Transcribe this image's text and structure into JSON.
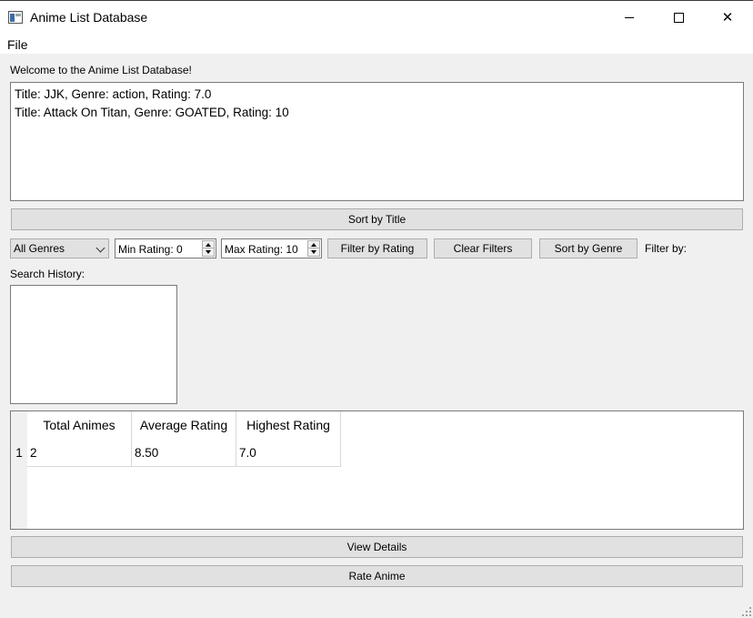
{
  "window": {
    "title": "Anime List Database",
    "minimize_glyph": "",
    "close_glyph": "✕"
  },
  "menu": {
    "file": "File"
  },
  "welcome_text": "Welcome to the Anime List Database!",
  "anime_list": [
    "Title: JJK, Genre: action, Rating: 7.0",
    "Title: Attack On Titan, Genre: GOATED, Rating: 10"
  ],
  "buttons": {
    "sort_by_title": "Sort by Title",
    "filter_by_rating": "Filter by Rating",
    "clear_filters": "Clear Filters",
    "sort_by_genre": "Sort by Genre",
    "view_details": "View Details",
    "rate_anime": "Rate Anime"
  },
  "filters": {
    "genre_selected": "All Genres",
    "min_rating": "Min Rating: 0",
    "max_rating": "Max Rating: 10",
    "filter_by_label": "Filter by:"
  },
  "search_history": {
    "label": "Search History:",
    "items": []
  },
  "stats_table": {
    "headers": [
      "Total Animes",
      "Average Rating",
      "Highest Rating"
    ],
    "rows": [
      {
        "row_label": "1",
        "cells": [
          "2",
          "8.50",
          "7.0"
        ]
      }
    ]
  },
  "icons": {
    "app": "app-window-icon",
    "minimize": "minimize-icon",
    "maximize": "maximize-icon",
    "close": "close-icon",
    "dropdown": "chevron-down-icon",
    "spin_up": "arrow-up-icon",
    "spin_down": "arrow-down-icon",
    "resize": "resize-grip-icon"
  }
}
